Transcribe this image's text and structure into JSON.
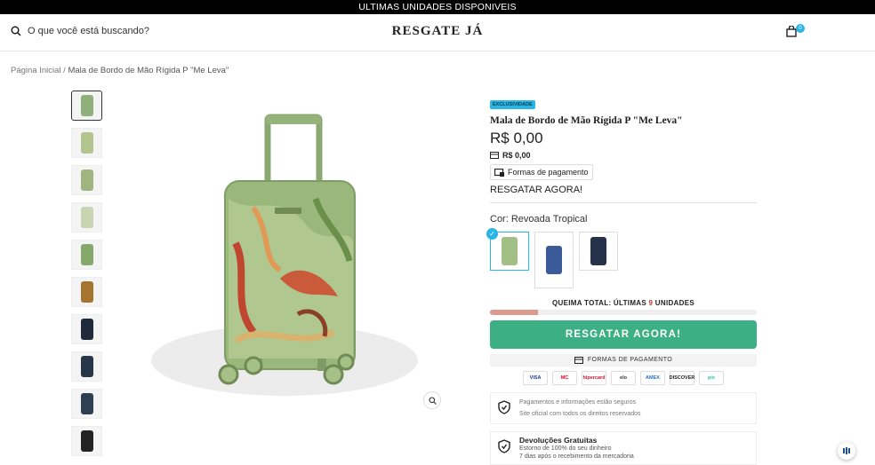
{
  "topbar": {
    "text": "ULTIMAS UNIDADES DISPONIVEIS"
  },
  "header": {
    "search_placeholder": "O que você está buscando?",
    "logo": "RESGATE JÁ",
    "cart_count": "0"
  },
  "breadcrumb": {
    "home": "Página Inicial",
    "separator": " / ",
    "current": "Mala de Bordo de Mão Rígida P \"Me Leva\""
  },
  "gallery": {
    "thumb_colors": [
      "#8fb07a",
      "#b3c48e",
      "#9fb57f",
      "#c9d5b0",
      "#86a86b",
      "#a5742f",
      "#1f2a3a",
      "#28364a",
      "#2f3f52",
      "#232323"
    ]
  },
  "product": {
    "badge": "EXCLUSIVIDADE",
    "title": "Mala de Bordo de Mão Rígida P \"Me Leva\"",
    "price": "R$ 0,00",
    "price_secondary": "R$ 0,00",
    "payment_chip": "Formas de pagamento",
    "resgatar_text": "RESGATAR AGORA!",
    "color_label": "Cor:",
    "color_value": "Revoada Tropical",
    "swatch_colors": [
      "#a2bf86",
      "#3b5a9a",
      "#26324a"
    ],
    "stock_prefix": "QUEIMA TOTAL: ÚLTIMAS ",
    "stock_number": "9",
    "stock_suffix": " UNIDADES",
    "stock_progress": 0.18,
    "cta": "RESGATAR AGORA!",
    "formas_label": "FORMAS DE PAGAMENTO",
    "cards": [
      "VISA",
      "MC",
      "hipercard",
      "elo",
      "AMEX",
      "DISCOVER",
      "pix"
    ],
    "secure_line1": "Pagamentos e informações estão seguros",
    "secure_line2": "Site oficial com todos os direitos reservados",
    "returns_title": "Devoluções Gratuitas",
    "returns_line1": "Estorno de 100% do seu dinheiro",
    "returns_line2": "7 dias após o recebimento da mercadoria"
  },
  "colors": {
    "accent": "#29b6e6",
    "cta": "#3daf85",
    "suitcase_green": "#9ab77c"
  }
}
